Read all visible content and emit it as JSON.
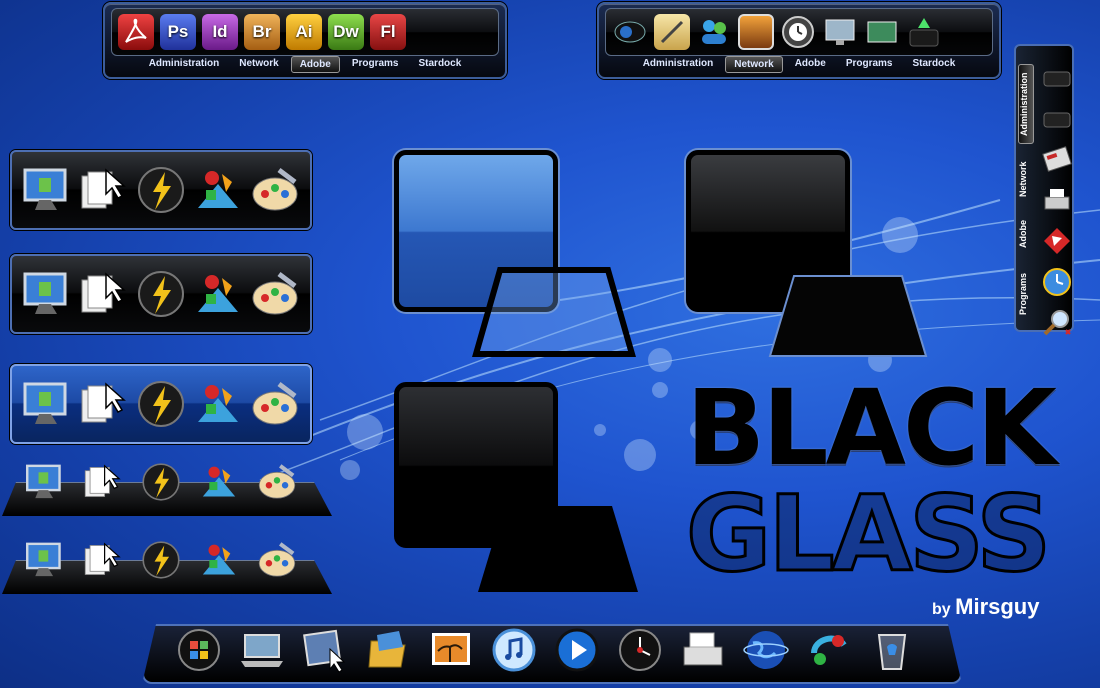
{
  "top_dock_left": {
    "icons": [
      {
        "name": "acrobat-icon",
        "label": "",
        "color": "#b51d1d"
      },
      {
        "name": "photoshop-icon",
        "label": "Ps",
        "color": "#2f49b5"
      },
      {
        "name": "indesign-icon",
        "label": "Id",
        "color": "#9b2fb8"
      },
      {
        "name": "bridge-icon",
        "label": "Br",
        "color": "#cf8a2a"
      },
      {
        "name": "illustrator-icon",
        "label": "Ai",
        "color": "#e3a010"
      },
      {
        "name": "dreamweaver-icon",
        "label": "Dw",
        "color": "#5aa72a"
      },
      {
        "name": "flash-icon",
        "label": "Fl",
        "color": "#b32020"
      }
    ],
    "tabs": [
      "Administration",
      "Network",
      "Adobe",
      "Programs",
      "Stardock"
    ],
    "active_tab": "Adobe"
  },
  "top_dock_right": {
    "icons": [
      "webcam-icon",
      "notes-icon",
      "messenger-icon",
      "photo-icon",
      "time-machine-icon",
      "monitor-icon",
      "desktop-icon",
      "drive-icon"
    ],
    "tabs": [
      "Administration",
      "Network",
      "Adobe",
      "Programs",
      "Stardock"
    ],
    "active_tab": "Network"
  },
  "side_docks": {
    "icons": [
      "my-computer-icon",
      "documents-icon",
      "power-icon",
      "shapes-icon",
      "paint-icon"
    ]
  },
  "right_dock": {
    "tabs": [
      "Administration",
      "Network",
      "Adobe",
      "Programs"
    ],
    "active_tab": "Administration",
    "icons": [
      "drive-icon",
      "drive-icon",
      "calculator-icon",
      "printer-icon",
      "flashget-icon",
      "clock-icon",
      "search-icon"
    ]
  },
  "bottom_dock": {
    "icons": [
      "windows-start-icon",
      "laptop-icon",
      "screen-icon",
      "folder-icon",
      "pictures-icon",
      "itunes-icon",
      "media-player-icon",
      "dashboard-icon",
      "scanner-icon",
      "globe-icon",
      "paint-icon",
      "recycle-bin-icon"
    ]
  },
  "branding": {
    "title_line1": "BLACK",
    "title_line2": "GLASS",
    "by": "by",
    "author": "Mirsguy"
  },
  "colors": {
    "background": "#1f54cf",
    "accent": "#4d6fb3"
  }
}
